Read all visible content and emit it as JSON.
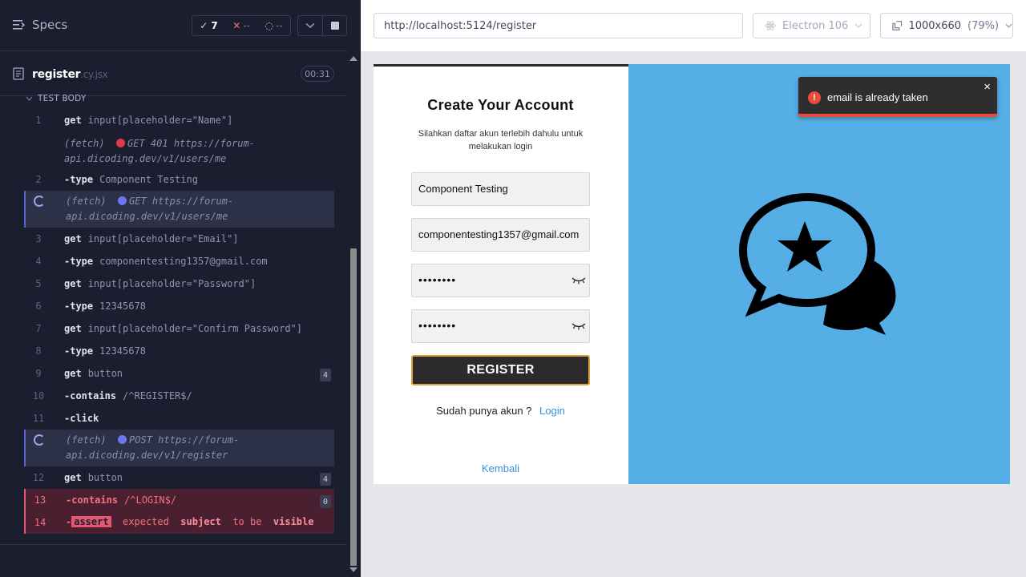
{
  "reporter": {
    "specs_label": "Specs",
    "stats": {
      "passed": "7",
      "failed": "--",
      "pending": "--"
    },
    "spec": {
      "name": "register",
      "ext": ".cy.jsx",
      "time": "00:31"
    },
    "test_body_label": "TEST BODY",
    "commands": [
      {
        "num": "1",
        "name": "get",
        "arg": "input[placeholder=\"Name\"]"
      },
      {
        "prefix": "(fetch)",
        "status_color": "#e4384f",
        "text": "GET 401 https://forum-api.dicoding.dev/v1/users/me"
      },
      {
        "num": "2",
        "name": "-type",
        "arg": "Component Testing"
      },
      {
        "prefix": "(fetch)",
        "status_color": "#6f75ef",
        "text": "GET https://forum-api.dicoding.dev/v1/users/me"
      },
      {
        "num": "3",
        "name": "get",
        "arg": "input[placeholder=\"Email\"]"
      },
      {
        "num": "4",
        "name": "-type",
        "arg": "componentesting1357@gmail.com"
      },
      {
        "num": "5",
        "name": "get",
        "arg": "input[placeholder=\"Password\"]"
      },
      {
        "num": "6",
        "name": "-type",
        "arg": "12345678"
      },
      {
        "num": "7",
        "name": "get",
        "arg": "input[placeholder=\"Confirm Password\"]"
      },
      {
        "num": "8",
        "name": "-type",
        "arg": "12345678"
      },
      {
        "num": "9",
        "name": "get",
        "arg": "button",
        "badge": "4"
      },
      {
        "num": "10",
        "name": "-contains",
        "arg": "/^REGISTER$/"
      },
      {
        "num": "11",
        "name": "-click",
        "arg": ""
      },
      {
        "prefix": "(fetch)",
        "status_color": "#6f75ef",
        "text": "POST https://forum-api.dicoding.dev/v1/register"
      },
      {
        "num": "12",
        "name": "get",
        "arg": "button",
        "badge": "4"
      },
      {
        "num": "13",
        "name": "-contains",
        "arg": "/^LOGIN$/",
        "badge": "0"
      },
      {
        "num": "14",
        "name": "-",
        "assert_tag": "assert",
        "msg": [
          "expected",
          "subject",
          "to be",
          "visible"
        ]
      }
    ]
  },
  "aut": {
    "url": "http://localhost:5124/register",
    "browser": "Electron 106",
    "viewport": "1000x660",
    "scale": "(79%)",
    "form": {
      "title": "Create Your Account",
      "subtitle": "Silahkan daftar akun terlebih dahulu untuk melakukan login",
      "name_value": "Component Testing",
      "email_value": "componentesting1357@gmail.com",
      "password_value": "••••••••",
      "confirm_value": "••••••••",
      "register_label": "REGISTER",
      "login_prompt": "Sudah punya akun ?",
      "login_link": "Login",
      "back_link": "Kembali"
    },
    "toast": {
      "message": "email is already taken",
      "close": "×",
      "icon": "!"
    }
  },
  "colors": {
    "reporter_bg": "#1b1e2e",
    "hero_bg": "#56aee6",
    "toast_accent": "#e74c3c",
    "link": "#3b8fd8",
    "button_border": "#e0a23c"
  }
}
